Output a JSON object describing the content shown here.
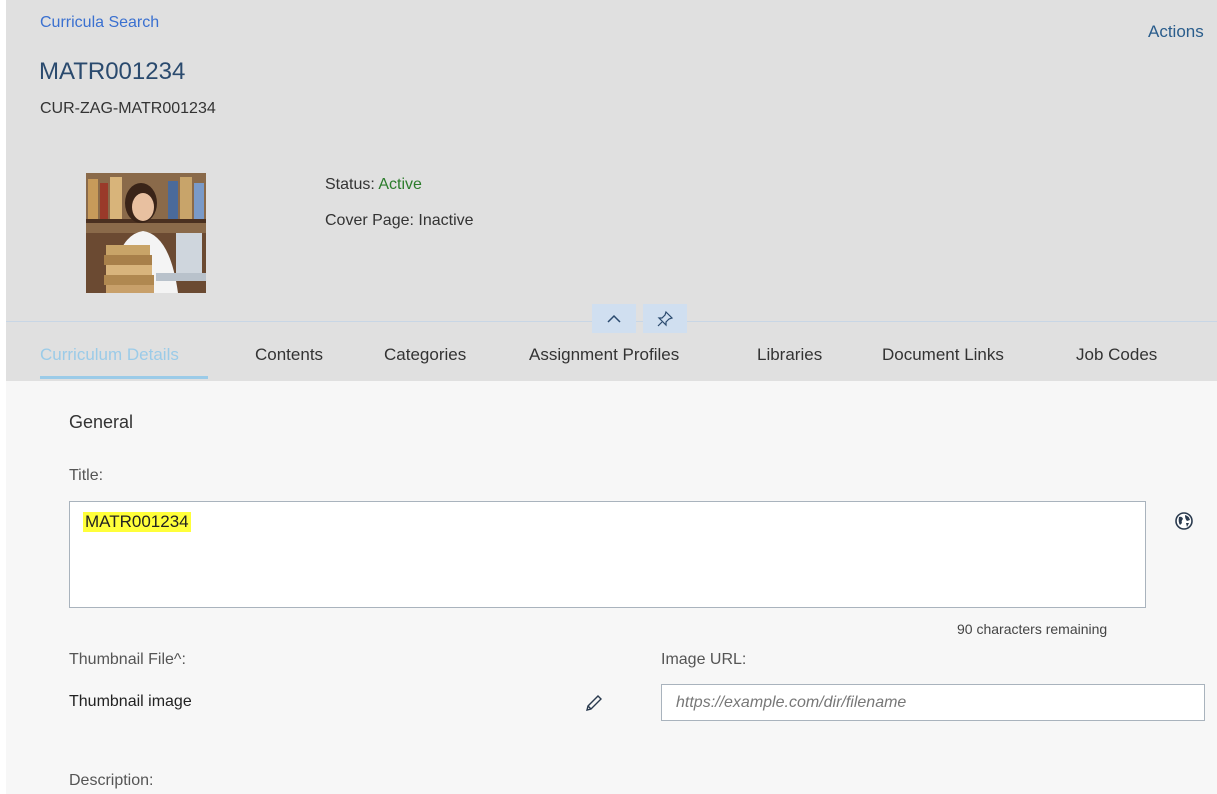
{
  "header": {
    "breadcrumb": "Curricula Search",
    "actions_label": "Actions",
    "title": "MATR001234",
    "subtitle": "CUR-ZAG-MATR001234",
    "status_label": "Status:",
    "status_value": "Active",
    "cover_page_label": "Cover Page:",
    "cover_page_value": "Inactive",
    "collapse_icon": "chevron-up-icon",
    "pin_icon": "pin-icon"
  },
  "tabs": [
    {
      "label": "Curriculum Details",
      "selected": true
    },
    {
      "label": "Contents",
      "selected": false
    },
    {
      "label": "Categories",
      "selected": false
    },
    {
      "label": "Assignment Profiles",
      "selected": false
    },
    {
      "label": "Libraries",
      "selected": false
    },
    {
      "label": "Document Links",
      "selected": false
    },
    {
      "label": "Job Codes",
      "selected": false
    }
  ],
  "form": {
    "section_title": "General",
    "title_label": "Title:",
    "title_value": "MATR001234",
    "chars_remaining": "90 characters remaining",
    "thumbnail_label": "Thumbnail File^:",
    "thumbnail_value": "Thumbnail image",
    "image_url_label": "Image URL:",
    "image_url_placeholder": "https://example.com/dir/filename",
    "description_label": "Description:"
  },
  "colors": {
    "header_bg": "#e0e0e0",
    "link": "#3a70d0",
    "status_active": "#2b7c2b",
    "tab_selected": "#9bcbe8",
    "highlight": "#ffff3a"
  }
}
